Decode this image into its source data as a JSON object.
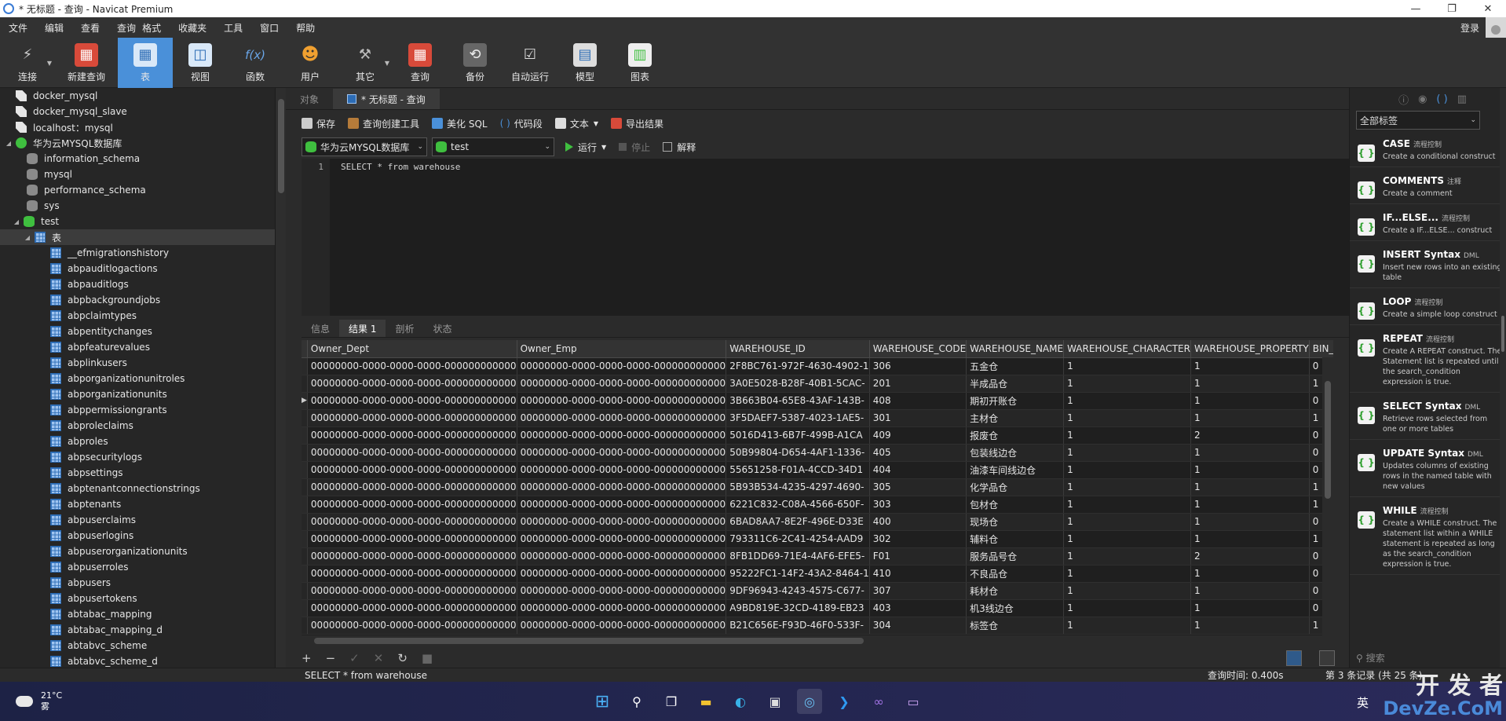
{
  "window": {
    "title": "* 无标题 - 查询 - Navicat Premium",
    "controls": [
      "—",
      "❐",
      "✕"
    ]
  },
  "menu": {
    "items": [
      "文件",
      "编辑",
      "查看",
      "查询",
      "格式",
      "收藏夹",
      "工具",
      "窗口",
      "帮助"
    ],
    "login": "登录"
  },
  "toolbar": {
    "items": [
      {
        "label": "连接",
        "icon": "plug-icon"
      },
      {
        "label": "新建查询",
        "icon": "new-query-icon"
      },
      {
        "label": "表",
        "icon": "table-icon"
      },
      {
        "label": "视图",
        "icon": "view-icon"
      },
      {
        "label": "函数",
        "icon": "function-icon",
        "glyph": "f(x)"
      },
      {
        "label": "用户",
        "icon": "user-icon"
      },
      {
        "label": "其它",
        "icon": "tools-icon"
      },
      {
        "label": "查询",
        "icon": "query-icon"
      },
      {
        "label": "备份",
        "icon": "backup-icon"
      },
      {
        "label": "自动运行",
        "icon": "automation-icon"
      },
      {
        "label": "模型",
        "icon": "model-icon"
      },
      {
        "label": "图表",
        "icon": "chart-icon"
      }
    ]
  },
  "navigator": {
    "connections": [
      "docker_mysql",
      "docker_mysql_slave",
      "localhost：mysql"
    ],
    "active_connection": "华为云MYSQL数据库",
    "databases": [
      "information_schema",
      "mysql",
      "performance_schema",
      "sys"
    ],
    "active_database": "test",
    "tables_folder": "表",
    "tables": [
      "__efmigrationshistory",
      "abpauditlogactions",
      "abpauditlogs",
      "abpbackgroundjobs",
      "abpclaimtypes",
      "abpentitychanges",
      "abpfeaturevalues",
      "abplinkusers",
      "abporganizationunitroles",
      "abporganizationunits",
      "abppermissiongrants",
      "abproleclaims",
      "abproles",
      "abpsecuritylogs",
      "abpsettings",
      "abptenantconnectionstrings",
      "abptenants",
      "abpuserclaims",
      "abpuserlogins",
      "abpuserorganizationunits",
      "abpuserroles",
      "abpusers",
      "abpusertokens",
      "abtabac_mapping",
      "abtabac_mapping_d",
      "abtabvc_scheme",
      "abtabvc_scheme_d"
    ]
  },
  "tabs": {
    "objects": "对象",
    "query": "* 无标题 - 查询"
  },
  "query_toolbar": {
    "save": "保存",
    "builder": "查询创建工具",
    "beautify": "美化 SQL",
    "snippet": "代码段",
    "text": "文本",
    "export": "导出结果"
  },
  "query_selectors": {
    "connection": "华为云MYSQL数据库",
    "database": "test",
    "run": "运行",
    "stop": "停止",
    "explain": "解释"
  },
  "editor": {
    "line_number": "1",
    "sql": "SELECT * from warehouse"
  },
  "result_tabs": [
    "信息",
    "结果 1",
    "剖析",
    "状态"
  ],
  "grid": {
    "columns": [
      "Owner_Dept",
      "Owner_Emp",
      "WAREHOUSE_ID",
      "WAREHOUSE_CODE",
      "WAREHOUSE_NAME",
      "WAREHOUSE_CHARACTER",
      "WAREHOUSE_PROPERTY",
      "BIN_CONTROL"
    ],
    "rows": [
      [
        "00000000-0000-0000-0000-000000000000",
        "00000000-0000-0000-0000-000000000000",
        "2F8BC761-972F-4630-4902-1",
        "306",
        "五金仓",
        "1",
        "1",
        "0"
      ],
      [
        "00000000-0000-0000-0000-000000000000",
        "00000000-0000-0000-0000-000000000000",
        "3A0E5028-B28F-40B1-5CAC-",
        "201",
        "半成品仓",
        "1",
        "1",
        "1"
      ],
      [
        "00000000-0000-0000-0000-000000000000",
        "00000000-0000-0000-0000-000000000000",
        "3B663B04-65E8-43AF-143B-",
        "408",
        "期初开账仓",
        "1",
        "1",
        "0"
      ],
      [
        "00000000-0000-0000-0000-000000000000",
        "00000000-0000-0000-0000-000000000000",
        "3F5DAEF7-5387-4023-1AE5-",
        "301",
        "主材仓",
        "1",
        "1",
        "1"
      ],
      [
        "00000000-0000-0000-0000-000000000000",
        "00000000-0000-0000-0000-000000000000",
        "5016D413-6B7F-499B-A1CA",
        "409",
        "报废仓",
        "1",
        "2",
        "0"
      ],
      [
        "00000000-0000-0000-0000-000000000000",
        "00000000-0000-0000-0000-000000000000",
        "50B99804-D654-4AF1-1336-",
        "405",
        "包装线边仓",
        "1",
        "1",
        "0"
      ],
      [
        "00000000-0000-0000-0000-000000000000",
        "00000000-0000-0000-0000-000000000000",
        "55651258-F01A-4CCD-34D1",
        "404",
        "油漆车间线边仓",
        "1",
        "1",
        "0"
      ],
      [
        "00000000-0000-0000-0000-000000000000",
        "00000000-0000-0000-0000-000000000000",
        "5B93B534-4235-4297-4690-",
        "305",
        "化学品仓",
        "1",
        "1",
        "1"
      ],
      [
        "00000000-0000-0000-0000-000000000000",
        "00000000-0000-0000-0000-000000000000",
        "6221C832-C08A-4566-650F-",
        "303",
        "包材仓",
        "1",
        "1",
        "1"
      ],
      [
        "00000000-0000-0000-0000-000000000000",
        "00000000-0000-0000-0000-000000000000",
        "6BAD8AA7-8E2F-496E-D33E",
        "400",
        "现场仓",
        "1",
        "1",
        "0"
      ],
      [
        "00000000-0000-0000-0000-000000000000",
        "00000000-0000-0000-0000-000000000000",
        "793311C6-2C41-4254-AAD9",
        "302",
        "辅料仓",
        "1",
        "1",
        "1"
      ],
      [
        "00000000-0000-0000-0000-000000000000",
        "00000000-0000-0000-0000-000000000000",
        "8FB1DD69-71E4-4AF6-EFE5-",
        "F01",
        "服务品号仓",
        "1",
        "2",
        "0"
      ],
      [
        "00000000-0000-0000-0000-000000000000",
        "00000000-0000-0000-0000-000000000000",
        "95222FC1-14F2-43A2-8464-1",
        "410",
        "不良品仓",
        "1",
        "1",
        "0"
      ],
      [
        "00000000-0000-0000-0000-000000000000",
        "00000000-0000-0000-0000-000000000000",
        "9DF96943-4243-4575-C677-",
        "307",
        "耗材仓",
        "1",
        "1",
        "0"
      ],
      [
        "00000000-0000-0000-0000-000000000000",
        "00000000-0000-0000-0000-000000000000",
        "A9BD819E-32CD-4189-EB23",
        "403",
        "机3线边仓",
        "1",
        "1",
        "0"
      ],
      [
        "00000000-0000-0000-0000-000000000000",
        "00000000-0000-0000-0000-000000000000",
        "B21C656E-F93D-46F0-533F-",
        "304",
        "标签仓",
        "1",
        "1",
        "1"
      ]
    ]
  },
  "snippets": {
    "filter": "全部标签",
    "items": [
      {
        "title": "CASE",
        "tag": "流程控制",
        "desc": "Create a conditional construct"
      },
      {
        "title": "COMMENTS",
        "tag": "注释",
        "desc": "Create a comment"
      },
      {
        "title": "IF...ELSE...",
        "tag": "流程控制",
        "desc": "Create a IF...ELSE... construct"
      },
      {
        "title": "INSERT Syntax",
        "tag": "DML",
        "desc": "Insert new rows into an existing table"
      },
      {
        "title": "LOOP",
        "tag": "流程控制",
        "desc": "Create a simple loop construct"
      },
      {
        "title": "REPEAT",
        "tag": "流程控制",
        "desc": "Create A REPEAT construct. The Statement list is repeated until the search_condition expression is true."
      },
      {
        "title": "SELECT Syntax",
        "tag": "DML",
        "desc": "Retrieve rows selected from one or more tables"
      },
      {
        "title": "UPDATE Syntax",
        "tag": "DML",
        "desc": "Updates columns of existing rows in the named table with new values"
      },
      {
        "title": "WHILE",
        "tag": "流程控制",
        "desc": "Create a WHILE construct. The statement list within a WHILE statement is repeated as long as the search_condition expression is true."
      }
    ],
    "search_placeholder": "搜索"
  },
  "status": {
    "sql": "SELECT * from warehouse",
    "time": "查询时间: 0.400s",
    "records": "第 3 条记录 (共 25 条)"
  },
  "taskbar": {
    "temperature": "21°C",
    "weather": "雾",
    "ime": "英"
  },
  "watermark": {
    "line1": "开 发 者",
    "line2": "DevZe.CoM"
  }
}
